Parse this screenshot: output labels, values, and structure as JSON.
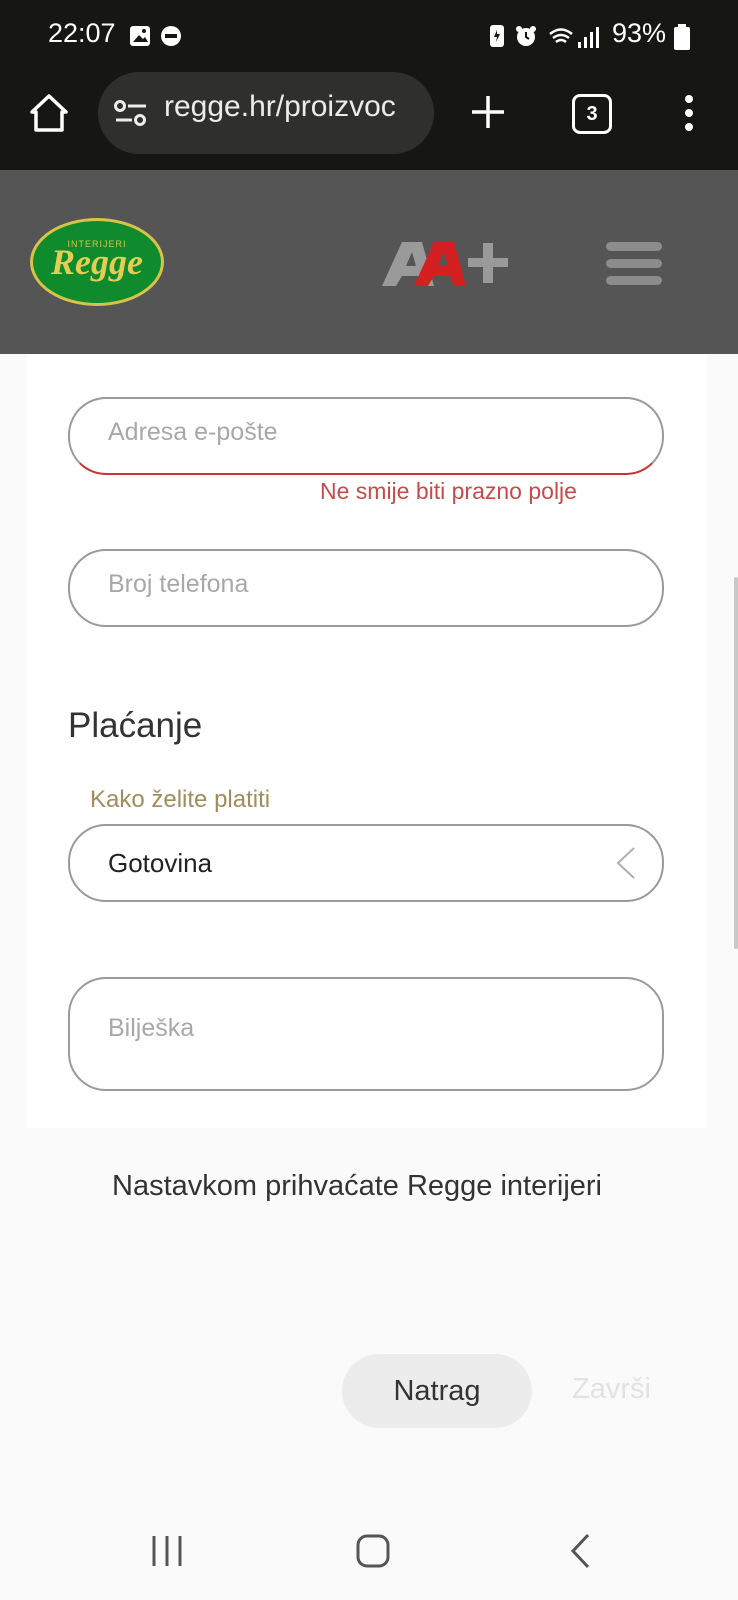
{
  "status_bar": {
    "time": "22:07",
    "battery": "93%"
  },
  "browser": {
    "url": "regge.hr/proizvoc",
    "tab_count": "3"
  },
  "header": {
    "logo_small": "INTERIJERI",
    "logo_name": "Regge",
    "energy_badge": "A+"
  },
  "form": {
    "email": {
      "placeholder": "Adresa e-pošte",
      "error": "Ne smije biti prazno polje"
    },
    "phone": {
      "placeholder": "Broj telefona"
    },
    "payment": {
      "title": "Plaćanje",
      "label": "Kako želite platiti",
      "selected": "Gotovina"
    },
    "note": {
      "placeholder": "Bilješka"
    },
    "terms_text": "Nastavkom prihvaćate Regge interijeri",
    "back_label": "Natrag",
    "finish_label": "Završi"
  },
  "colors": {
    "error": "#c94a4a",
    "label_gold": "#a08d5c",
    "header_bg": "#555555",
    "logo_green": "#0f8a2c",
    "badge_red": "#d42020"
  }
}
